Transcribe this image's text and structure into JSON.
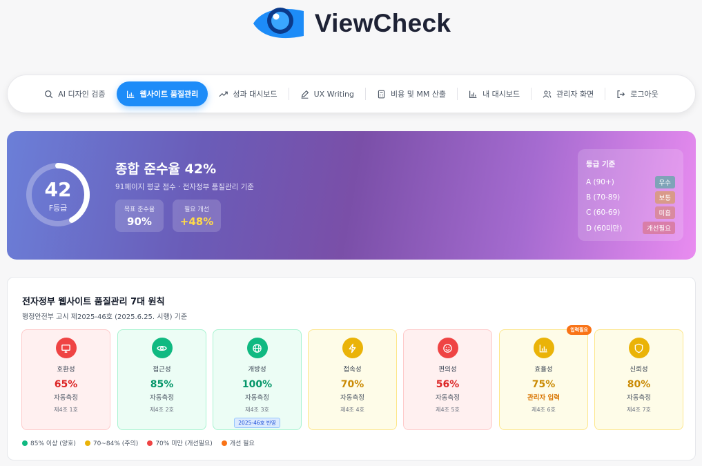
{
  "app": {
    "title": "ViewCheck"
  },
  "nav": {
    "items": [
      {
        "label": "AI 디자인 검증",
        "icon": "search-icon",
        "active": false
      },
      {
        "label": "웹사이트 품질관리",
        "icon": "bar-chart-icon",
        "active": true
      },
      {
        "label": "성과 대시보드",
        "icon": "trend-up-icon",
        "active": false
      },
      {
        "label": "UX Writing",
        "icon": "pen-icon",
        "active": false
      },
      {
        "label": "비용 및 MM 산출",
        "icon": "calculator-icon",
        "active": false
      },
      {
        "label": "내 대시보드",
        "icon": "bar-chart-icon",
        "active": false
      },
      {
        "label": "관리자 화면",
        "icon": "users-icon",
        "active": false
      },
      {
        "label": "로그아웃",
        "icon": "logout-icon",
        "active": false
      }
    ]
  },
  "summary": {
    "score": "42",
    "score_value": 42,
    "grade": "F등급",
    "title": "종합 준수율 42%",
    "subtitle": "91페이지 평균 점수 · 전자정부 품질관리 기준",
    "target_label": "목표 준수율",
    "target_value": "90%",
    "improve_label": "필요 개선",
    "improve_value": "+48%"
  },
  "grade_criteria": {
    "title": "등급 기준",
    "rows": [
      {
        "range": "A (90+)",
        "badge": "우수",
        "color": "#7fa3b8"
      },
      {
        "range": "B (70-89)",
        "badge": "보통",
        "color": "#d99a8a"
      },
      {
        "range": "C (60-69)",
        "badge": "미흡",
        "color": "#d98aa0"
      },
      {
        "range": "D (60미만)",
        "badge": "개선필요",
        "color": "#d97ea8"
      }
    ]
  },
  "principles": {
    "title": "전자정부 웹사이트 품질관리 7대 원칙",
    "subtitle": "행정안전부 고시 제2025-46호 (2025.6.25. 시행) 기준",
    "items": [
      {
        "name": "호환성",
        "score": "65%",
        "mode": "자동측정",
        "ref": "제4조 1호",
        "icon": "monitor-icon",
        "status": "red"
      },
      {
        "name": "접근성",
        "score": "85%",
        "mode": "자동측정",
        "ref": "제4조 2호",
        "icon": "eye-icon",
        "status": "green"
      },
      {
        "name": "개방성",
        "score": "100%",
        "mode": "자동측정",
        "ref": "제4조 3호",
        "icon": "globe-icon",
        "status": "green",
        "tag": "2025-46호 반영"
      },
      {
        "name": "접속성",
        "score": "70%",
        "mode": "자동측정",
        "ref": "제4조 4호",
        "icon": "lightning-icon",
        "status": "yellow"
      },
      {
        "name": "편의성",
        "score": "56%",
        "mode": "자동측정",
        "ref": "제4조 5호",
        "icon": "smile-icon",
        "status": "red"
      },
      {
        "name": "효율성",
        "score": "75%",
        "mode": "관리자 입력",
        "ref": "제4조 6호",
        "icon": "bar-chart-icon",
        "status": "yellow",
        "flag": "입력필요"
      },
      {
        "name": "신뢰성",
        "score": "80%",
        "mode": "자동측정",
        "ref": "제4조 7호",
        "icon": "shield-icon",
        "status": "yellow"
      }
    ]
  },
  "legend": [
    {
      "label": "85% 이상 (양호)",
      "color": "#10b981"
    },
    {
      "label": "70~84% (주의)",
      "color": "#eab308"
    },
    {
      "label": "70% 미만 (개선필요)",
      "color": "#ef4444"
    },
    {
      "label": "개선 필요",
      "color": "#f97316"
    }
  ],
  "colors": {
    "accent": "#1d8cf8",
    "green": "#10b981",
    "yellow": "#eab308",
    "red": "#ef4444",
    "orange": "#f97316"
  }
}
